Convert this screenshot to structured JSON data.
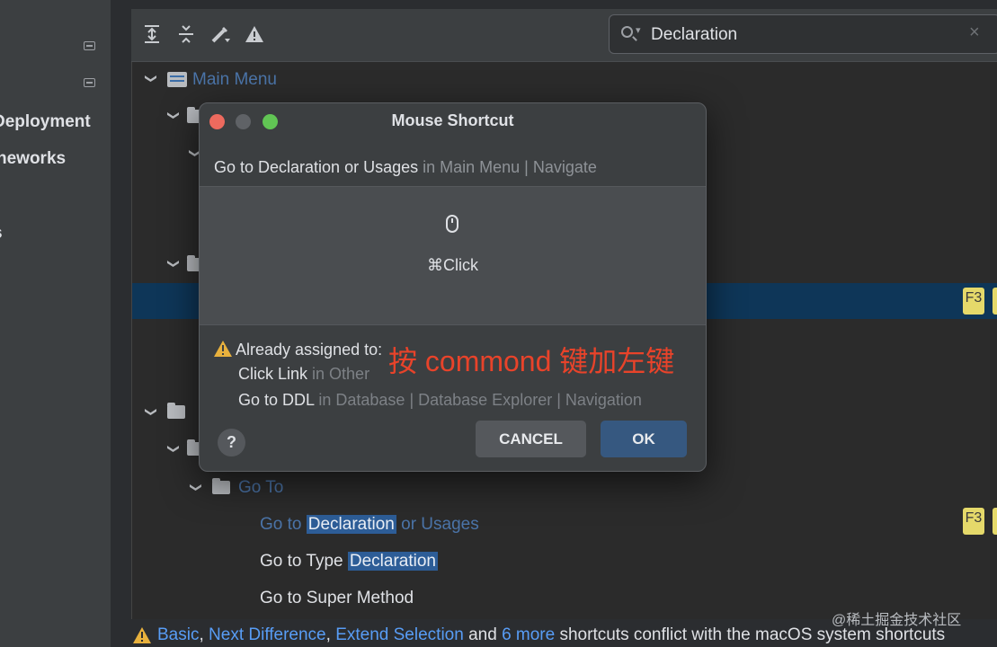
{
  "sidebar": {
    "items": [
      {
        "label": "Deployment",
        "full": "Build, Execution, Deployment"
      },
      {
        "label": "neworks",
        "full": "Frameworks"
      },
      {
        "label": "s"
      }
    ]
  },
  "search": {
    "value": "Declaration",
    "clear": "×"
  },
  "tree": {
    "main_menu": "Main Menu",
    "goto_folder": "Go To",
    "decl_prefix": "Go to ",
    "decl_match": "Declaration",
    "decl_suffix": " or Usages",
    "type_prefix": "Go to Type ",
    "type_match": "Declaration",
    "super_method": "Go to Super Method",
    "f3": "F3"
  },
  "dialog": {
    "title": "Mouse Shortcut",
    "action": "Go to Declaration or Usages",
    "action_location": " in Main Menu | Navigate",
    "shortcut": "⌘Click",
    "already_assigned": "Already assigned to:",
    "conflicts": [
      {
        "name": "Click Link",
        "location": " in Other"
      },
      {
        "name": "Go to DDL",
        "location": " in Database | Database Explorer | Navigation"
      }
    ],
    "help": "?",
    "cancel": "CANCEL",
    "ok": "OK"
  },
  "annotation": "按 commond 键加左键",
  "status": {
    "link1": "Basic",
    "sep1": ", ",
    "link2": "Next Difference",
    "sep2": ", ",
    "link3": "Extend Selection",
    "and": " and ",
    "link4": "6 more",
    "rest": " shortcuts conflict with the macOS system shortcuts"
  },
  "watermark": "@稀土掘金技术社区",
  "colors": {
    "accent": "#589df6",
    "selection": "#0e3658",
    "annotation": "#e8432a",
    "ok": "#365880"
  }
}
